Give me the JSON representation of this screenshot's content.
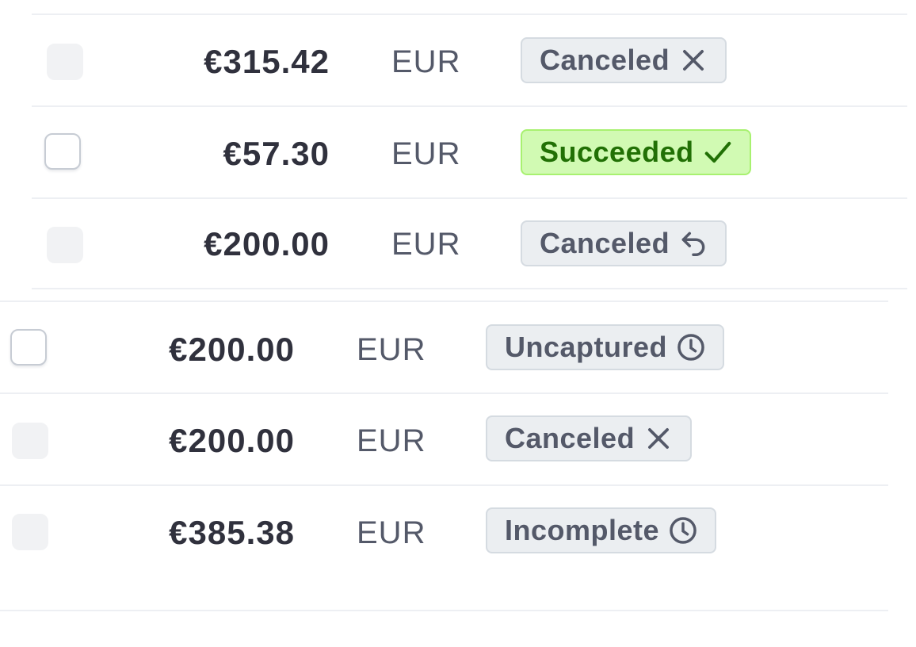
{
  "payments_top": [
    {
      "amount": "€315.42",
      "currency": "EUR",
      "status": "Canceled",
      "status_icon": "x-icon",
      "checkbox_enabled": false
    },
    {
      "amount": "€57.30",
      "currency": "EUR",
      "status": "Succeeded",
      "status_icon": "checkmark-icon",
      "checkbox_enabled": true
    },
    {
      "amount": "€200.00",
      "currency": "EUR",
      "status": "Canceled",
      "status_icon": "reply-arrow-icon",
      "checkbox_enabled": false
    }
  ],
  "payments_bottom": [
    {
      "amount": "€200.00",
      "currency": "EUR",
      "status": "Uncaptured",
      "status_icon": "clock-icon",
      "checkbox_enabled": true
    },
    {
      "amount": "€200.00",
      "currency": "EUR",
      "status": "Canceled",
      "status_icon": "x-icon",
      "checkbox_enabled": false
    },
    {
      "amount": "€385.38",
      "currency": "EUR",
      "status": "Incomplete",
      "status_icon": "clock-icon",
      "checkbox_enabled": false
    }
  ],
  "colors": {
    "neutral_badge_bg": "#ebeef1",
    "neutral_badge_text": "#545969",
    "success_badge_bg": "#d1fab3",
    "success_badge_text": "#217005",
    "divider": "#edeff3"
  }
}
